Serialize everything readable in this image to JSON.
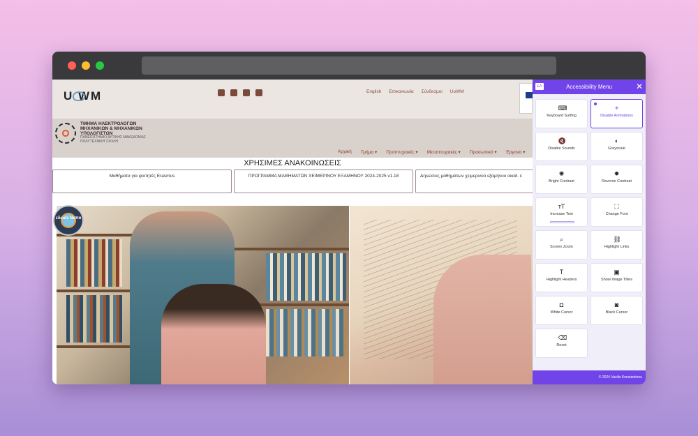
{
  "browser": {
    "url": ""
  },
  "site": {
    "logo_text": "U  WM",
    "social_icons": [
      "rss-icon",
      "facebook-icon",
      "twitter-icon",
      "youtube-icon"
    ],
    "top_links": [
      "English",
      "Επικοινωνία",
      "Σύνδεσμοι",
      "UoWM"
    ],
    "dept_name_lines": [
      "ΤΜΗΜΑ ΗΛΕΚΤΡΟΛΟΓΩΝ",
      "ΜΗΧΑΝΙΚΩΝ & ΜΗΧΑΝΙΚΩΝ",
      "ΥΠΟΛΟΓΙΣΤΩΝ"
    ],
    "dept_sub_lines": [
      "ΠΑΝΕΠΙΣΤΗΜΙΟ ΔΥΤΙΚΗΣ ΜΑΚΕΔΟΝΙΑΣ",
      "ΠΟΛΥΤΕΧΝΙΚΗ ΣΧΟΛΗ"
    ],
    "nav": [
      "Αρχική",
      "Τμήμα ▾",
      "Προπτυχιακές ▾",
      "Μεταπτυχιακές ▾",
      "Προσωπικό ▾",
      "Έργανα ▾"
    ],
    "announcements_title": "ΧΡΗΣΙΜΕΣ ΑΝΑΚΟΙΝΩΣΕΙΣ",
    "announcements": [
      "Μαθήματα για φοιτητές Erasmus",
      "ΠΡΟΓΡΑΜΜΑ ΜΑΘΗΜΑΤΩΝ ΧΕΙΜΕΡΙΝΟΥ ΕΞΑΜΗΝΟΥ 2024-2025 v1.18",
      "Δηλώσεις μαθημάτων χειμερινού εξαμήνου ακαδ. έ"
    ],
    "badge_text": "εδώσε Ναπα"
  },
  "accessibility": {
    "lang": "ΕΛ",
    "title": "Accessibility Menu",
    "close": "✕",
    "accent": "#7044e8",
    "tiles": [
      {
        "name": "keyboard-surfing",
        "label": "Keyboard Surfing",
        "icon": "⌨",
        "icon_name": "keyboard-icon",
        "active": false
      },
      {
        "name": "disable-animations",
        "label": "Disable Animations",
        "icon": "⌖",
        "icon_name": "cursor-slash-icon",
        "active": true
      },
      {
        "name": "disable-sounds",
        "label": "Disable Sounds",
        "icon": "🔇",
        "icon_name": "mute-icon",
        "active": false
      },
      {
        "name": "greyscale",
        "label": "Greyscale",
        "icon": "◐",
        "icon_name": "contrast-half-icon",
        "active": false
      },
      {
        "name": "bright-contrast",
        "label": "Bright Contrast",
        "icon": "✺",
        "icon_name": "sun-icon",
        "active": false
      },
      {
        "name": "reverse-contrast",
        "label": "Reverse Contrast",
        "icon": "✹",
        "icon_name": "sun-filled-icon",
        "active": false
      },
      {
        "name": "increase-text",
        "label": "Increase Text",
        "icon": "ᴛT",
        "icon_name": "text-size-icon",
        "active": false,
        "bar": true
      },
      {
        "name": "change-font",
        "label": "Change Font",
        "icon": "⛶",
        "icon_name": "font-frame-icon",
        "active": false
      },
      {
        "name": "screen-zoom",
        "label": "Screen Zoom",
        "icon": "⌕",
        "icon_name": "zoom-icon",
        "active": false
      },
      {
        "name": "highlight-links",
        "label": "Highlight Links",
        "icon": "⛓",
        "icon_name": "link-icon",
        "active": false
      },
      {
        "name": "highlight-headers",
        "label": "Highlight Headers",
        "icon": "T",
        "icon_name": "header-icon",
        "active": false
      },
      {
        "name": "show-image-titles",
        "label": "Show Image Titles",
        "icon": "▣",
        "icon_name": "image-icon",
        "active": false
      },
      {
        "name": "white-cursor",
        "label": "White Cursor",
        "icon": "◘",
        "icon_name": "mouse-white-icon",
        "active": false
      },
      {
        "name": "black-cursor",
        "label": "Black Cursor",
        "icon": "◙",
        "icon_name": "mouse-black-icon",
        "active": false
      },
      {
        "name": "reset",
        "label": "Reset",
        "icon": "⌫",
        "icon_name": "reset-icon",
        "active": false
      }
    ],
    "footer": "© 2024 Vasilis Konstantinou"
  }
}
